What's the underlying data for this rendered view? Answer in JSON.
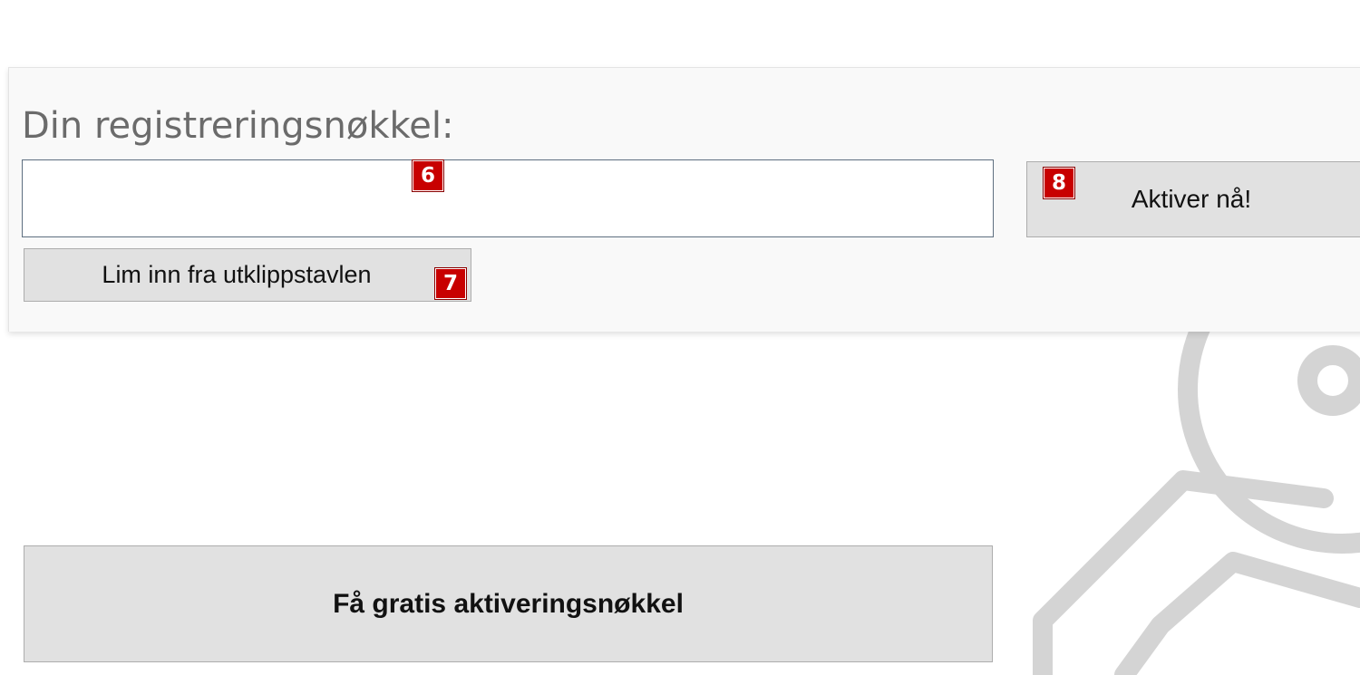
{
  "registration": {
    "title": "Din registreringsnøkkel:",
    "key_value": "",
    "placeholder": "",
    "paste_label": "Lim inn fra utklippstavlen",
    "activate_label": "Aktiver nå!"
  },
  "free_key": {
    "button_label": "Få gratis aktiveringsnøkkel"
  },
  "markers": {
    "input": "6",
    "paste": "7",
    "activate": "8"
  },
  "icons": {
    "background": "key-icon"
  },
  "colors": {
    "marker": "#c80000",
    "button_bg": "#e1e1e1",
    "panel_bg": "#f9f9f9",
    "title": "#6b6b6b",
    "key_graphic": "#d4d4d4"
  }
}
